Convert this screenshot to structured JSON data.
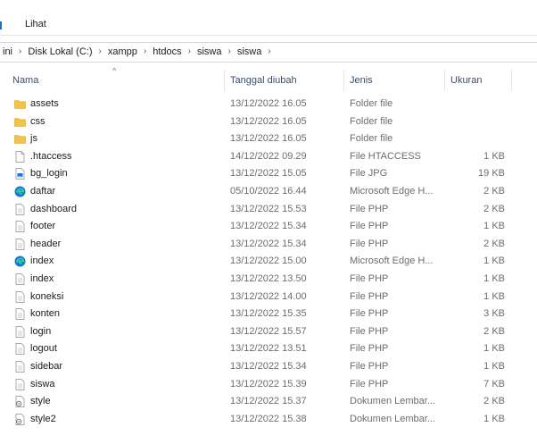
{
  "ribbon": {
    "tab_view": "Lihat"
  },
  "breadcrumb": [
    "ini",
    "Disk Lokal (C:)",
    "xampp",
    "htdocs",
    "siswa",
    "siswa"
  ],
  "columns": {
    "name": "Nama",
    "date": "Tanggal diubah",
    "type": "Jenis",
    "size": "Ukuran"
  },
  "colors": {
    "folder": "#f3c24a",
    "edge": "#1e6fd0",
    "accent": "#1e6fd0"
  },
  "files": [
    {
      "name": "assets",
      "date": "13/12/2022 16.05",
      "type": "Folder file",
      "size": "",
      "icon": "folder-icon"
    },
    {
      "name": "css",
      "date": "13/12/2022 16.05",
      "type": "Folder file",
      "size": "",
      "icon": "folder-icon"
    },
    {
      "name": "js",
      "date": "13/12/2022 16.05",
      "type": "Folder file",
      "size": "",
      "icon": "folder-icon"
    },
    {
      "name": ".htaccess",
      "date": "14/12/2022 09.29",
      "type": "File HTACCESS",
      "size": "1 KB",
      "icon": "blank-file-icon"
    },
    {
      "name": "bg_login",
      "date": "13/12/2022 15.05",
      "type": "File JPG",
      "size": "19 KB",
      "icon": "image-file-icon"
    },
    {
      "name": "daftar",
      "date": "05/10/2022 16.44",
      "type": "Microsoft Edge H...",
      "size": "2 KB",
      "icon": "edge-icon"
    },
    {
      "name": "dashboard",
      "date": "13/12/2022 15.53",
      "type": "File PHP",
      "size": "2 KB",
      "icon": "text-file-icon"
    },
    {
      "name": "footer",
      "date": "13/12/2022 15.34",
      "type": "File PHP",
      "size": "1 KB",
      "icon": "text-file-icon"
    },
    {
      "name": "header",
      "date": "13/12/2022 15.34",
      "type": "File PHP",
      "size": "2 KB",
      "icon": "text-file-icon"
    },
    {
      "name": "index",
      "date": "13/12/2022 15.00",
      "type": "Microsoft Edge H...",
      "size": "1 KB",
      "icon": "edge-icon"
    },
    {
      "name": "index",
      "date": "13/12/2022 13.50",
      "type": "File PHP",
      "size": "1 KB",
      "icon": "text-file-icon"
    },
    {
      "name": "koneksi",
      "date": "13/12/2022 14.00",
      "type": "File PHP",
      "size": "1 KB",
      "icon": "text-file-icon"
    },
    {
      "name": "konten",
      "date": "13/12/2022 15.35",
      "type": "File PHP",
      "size": "3 KB",
      "icon": "text-file-icon"
    },
    {
      "name": "login",
      "date": "13/12/2022 15.57",
      "type": "File PHP",
      "size": "2 KB",
      "icon": "text-file-icon"
    },
    {
      "name": "logout",
      "date": "13/12/2022 13.51",
      "type": "File PHP",
      "size": "1 KB",
      "icon": "text-file-icon"
    },
    {
      "name": "sidebar",
      "date": "13/12/2022 15.34",
      "type": "File PHP",
      "size": "1 KB",
      "icon": "text-file-icon"
    },
    {
      "name": "siswa",
      "date": "13/12/2022 15.39",
      "type": "File PHP",
      "size": "7 KB",
      "icon": "text-file-icon"
    },
    {
      "name": "style",
      "date": "13/12/2022 15.37",
      "type": "Dokumen Lembar...",
      "size": "2 KB",
      "icon": "css-file-icon"
    },
    {
      "name": "style2",
      "date": "13/12/2022 15.38",
      "type": "Dokumen Lembar...",
      "size": "1 KB",
      "icon": "css-file-icon"
    }
  ]
}
